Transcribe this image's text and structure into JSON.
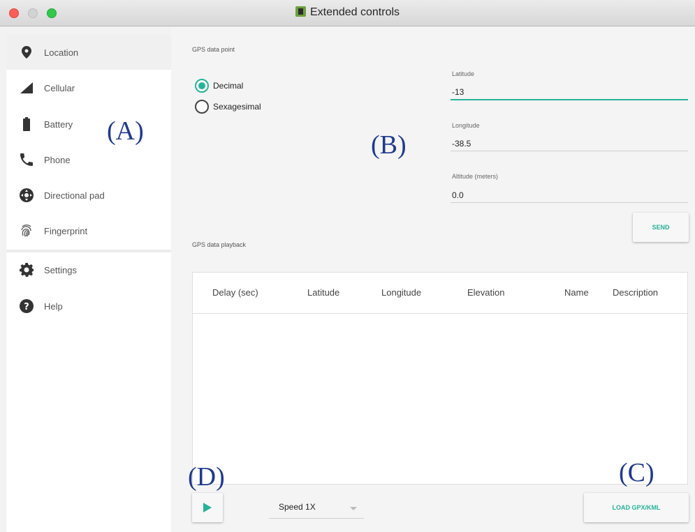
{
  "window": {
    "title": "Extended controls"
  },
  "sidebar": {
    "items": [
      {
        "label": "Location",
        "icon": "location-pin-icon",
        "active": true
      },
      {
        "label": "Cellular",
        "icon": "signal-icon"
      },
      {
        "label": "Battery",
        "icon": "battery-icon"
      },
      {
        "label": "Phone",
        "icon": "phone-icon"
      },
      {
        "label": "Directional pad",
        "icon": "dpad-icon"
      },
      {
        "label": "Fingerprint",
        "icon": "fingerprint-icon"
      },
      {
        "label": "Settings",
        "icon": "gear-icon"
      },
      {
        "label": "Help",
        "icon": "help-icon"
      }
    ]
  },
  "gps_point": {
    "section_title": "GPS data point",
    "format_options": [
      {
        "label": "Decimal",
        "selected": true
      },
      {
        "label": "Sexagesimal",
        "selected": false
      }
    ],
    "latitude_label": "Latitude",
    "latitude_value": "-13",
    "longitude_label": "Longitude",
    "longitude_value": "-38.5",
    "altitude_label": "Altitude (meters)",
    "altitude_value": "0.0",
    "send_label": "SEND"
  },
  "gps_playback": {
    "section_title": "GPS data playback",
    "columns": [
      "Delay (sec)",
      "Latitude",
      "Longitude",
      "Elevation",
      "Name",
      "Description"
    ],
    "speed_label": "Speed 1X",
    "load_label": "LOAD GPX/KML"
  },
  "annotations": [
    "(A)",
    "(B)",
    "(C)",
    "(D)"
  ],
  "colors": {
    "accent": "#26b39a",
    "annotation": "#1f3a8f"
  }
}
